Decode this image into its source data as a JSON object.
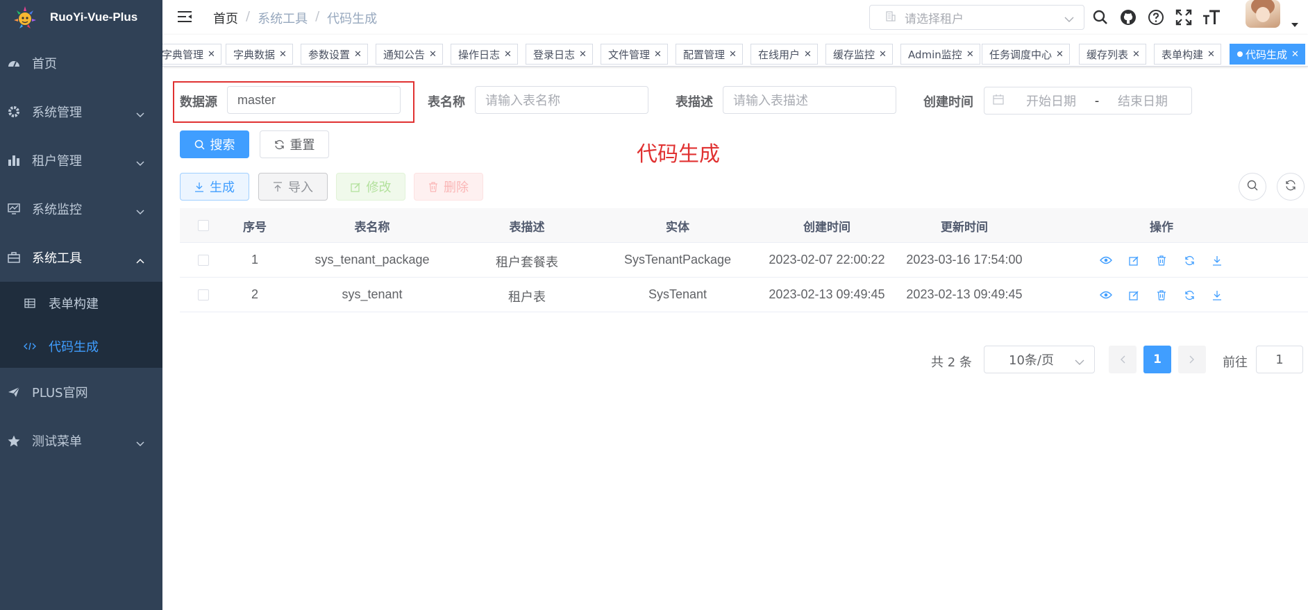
{
  "app": {
    "title": "RuoYi-Vue-Plus"
  },
  "sidebar": {
    "items": [
      {
        "label": "首页",
        "icon": "dashboard-icon"
      },
      {
        "label": "系统管理",
        "icon": "gear-icon"
      },
      {
        "label": "租户管理",
        "icon": "chart-icon"
      },
      {
        "label": "系统监控",
        "icon": "monitor-icon"
      },
      {
        "label": "系统工具",
        "icon": "toolbox-icon",
        "expanded": true,
        "children": [
          {
            "label": "表单构建",
            "icon": "grid-icon"
          },
          {
            "label": "代码生成",
            "icon": "code-icon",
            "active": true
          }
        ]
      },
      {
        "label": "PLUS官网",
        "icon": "send-icon"
      },
      {
        "label": "测试菜单",
        "icon": "star-icon"
      }
    ]
  },
  "navbar": {
    "breadcrumb": [
      "首页",
      "系统工具",
      "代码生成"
    ],
    "tenant_placeholder": "请选择租户"
  },
  "tags": [
    "字典管理",
    "字典数据",
    "参数设置",
    "通知公告",
    "操作日志",
    "登录日志",
    "文件管理",
    "配置管理",
    "在线用户",
    "缓存监控",
    "Admin监控",
    "任务调度中心",
    "缓存列表",
    "表单构建",
    "代码生成"
  ],
  "search": {
    "datasource_label": "数据源",
    "datasource_value": "master",
    "table_name_label": "表名称",
    "table_name_placeholder": "请输入表名称",
    "table_desc_label": "表描述",
    "table_desc_placeholder": "请输入表描述",
    "created_label": "创建时间",
    "start_placeholder": "开始日期",
    "range_sep": "-",
    "end_placeholder": "结束日期",
    "search_btn": "搜索",
    "reset_btn": "重置"
  },
  "toolbar": {
    "generate": "生成",
    "import": "导入",
    "edit": "修改",
    "delete": "删除"
  },
  "page_heading": "代码生成",
  "table": {
    "columns": [
      "序号",
      "表名称",
      "表描述",
      "实体",
      "创建时间",
      "更新时间",
      "操作"
    ],
    "rows": [
      {
        "index": "1",
        "name": "sys_tenant_package",
        "desc": "租户套餐表",
        "entity": "SysTenantPackage",
        "created": "2023-02-07 22:00:22",
        "updated": "2023-03-16 17:54:00"
      },
      {
        "index": "2",
        "name": "sys_tenant",
        "desc": "租户表",
        "entity": "SysTenant",
        "created": "2023-02-13 09:49:45",
        "updated": "2023-02-13 09:49:45"
      }
    ]
  },
  "pagination": {
    "total_text": "共 2 条",
    "page_size": "10条/页",
    "current": "1",
    "goto_label": "前往",
    "goto_value": "1"
  },
  "colors": {
    "primary": "#409eff",
    "sidebar": "#304156",
    "highlight": "#e03131"
  }
}
